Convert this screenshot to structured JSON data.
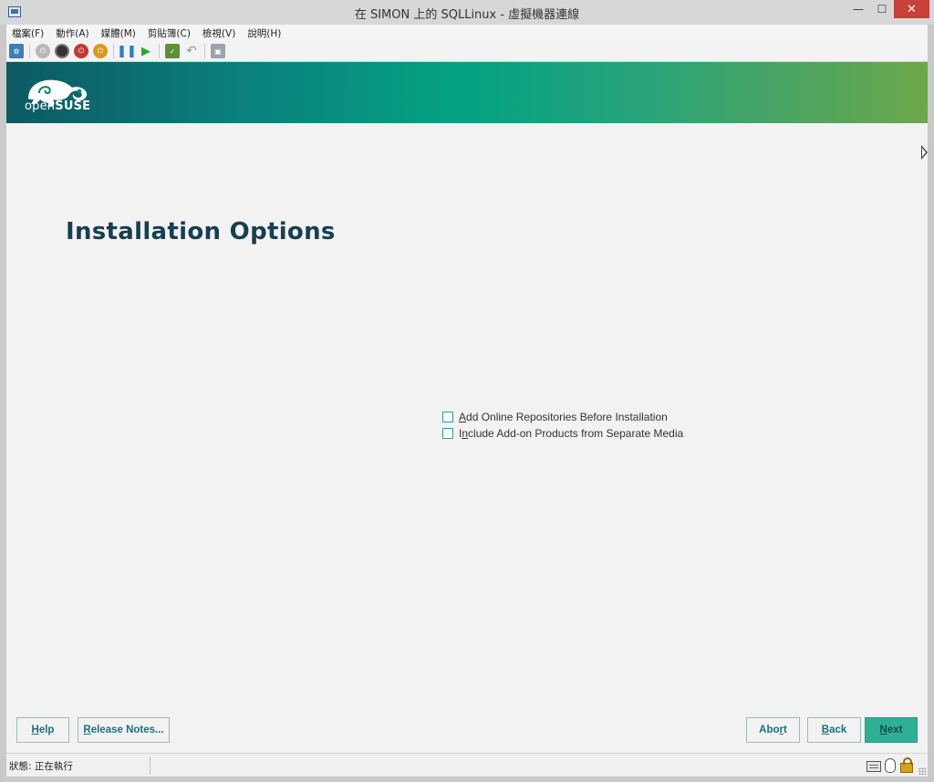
{
  "window": {
    "title": "在 SIMON 上的 SQLLinux - 虛擬機器連線",
    "minimize_glyph": "—",
    "maximize_glyph": "☐",
    "close_glyph": "✕"
  },
  "menu": {
    "items": [
      "檔案(F)",
      "動作(A)",
      "媒體(M)",
      "剪貼簿(C)",
      "檢視(V)",
      "說明(H)"
    ]
  },
  "toolbar": {
    "icons": [
      "ctrl-alt-del-icon",
      "start-icon",
      "turn-off-icon",
      "shutdown-icon",
      "save-icon",
      "pause-icon",
      "resume-icon",
      "checkpoint-icon",
      "revert-icon",
      "enhanced-session-icon"
    ]
  },
  "installer": {
    "logo_text_open": "open",
    "logo_text_suse": "SUSE",
    "page_title": "Installation Options",
    "options": [
      {
        "label_pre": "",
        "label_accel": "A",
        "label_post": "dd Online Repositories Before Installation",
        "checked": false
      },
      {
        "label_pre": "I",
        "label_accel": "n",
        "label_post": "clude Add-on Products from Separate Media",
        "checked": false
      }
    ],
    "buttons": {
      "help": {
        "accel": "H",
        "rest": "elp"
      },
      "release_notes": {
        "accel": "R",
        "rest": "elease Notes..."
      },
      "abort": {
        "pre": "Abo",
        "accel": "r",
        "rest": "t"
      },
      "back": {
        "accel": "B",
        "rest": "ack"
      },
      "next": {
        "accel": "N",
        "rest": "ext"
      }
    },
    "colors": {
      "accent": "#2fb095",
      "title": "#173f4f",
      "button_text": "#1d6f7a"
    }
  },
  "status": {
    "text": "狀態: 正在執行"
  }
}
